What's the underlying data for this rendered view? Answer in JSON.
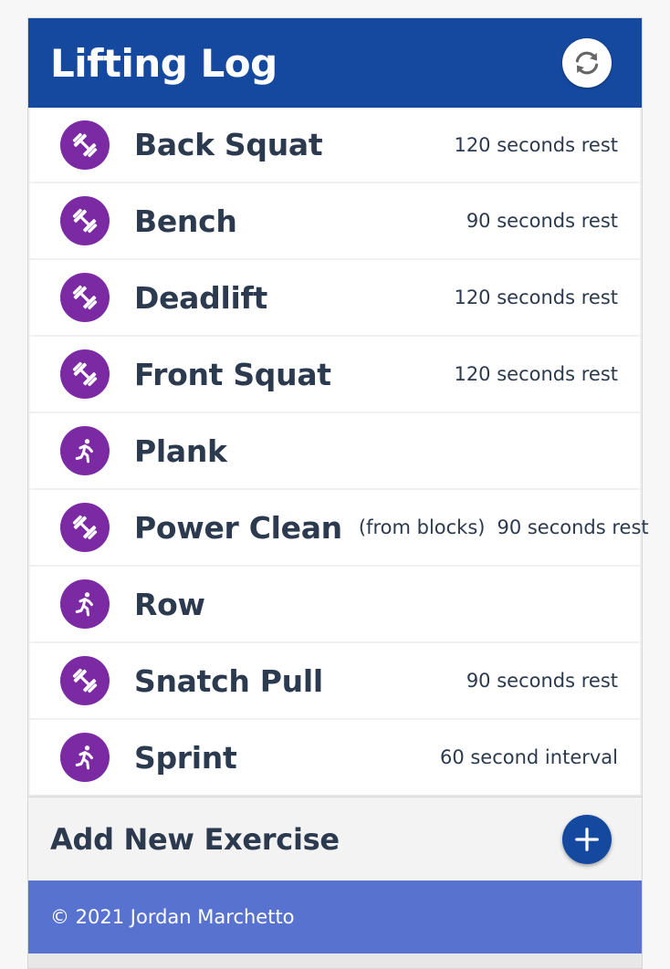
{
  "app": {
    "title": "Lifting Log",
    "sync_icon": "sync-icon"
  },
  "colors": {
    "header_bg": "#1549a0",
    "avatar_bg": "#7b2aa3",
    "text": "#2b3a4e",
    "footer_bg": "#5873cf"
  },
  "exercises": [
    {
      "name": "Back Squat",
      "note": "",
      "rest": "120 seconds rest",
      "icon": "dumbbell-icon"
    },
    {
      "name": "Bench",
      "note": "",
      "rest": "90 seconds rest",
      "icon": "dumbbell-icon"
    },
    {
      "name": "Deadlift",
      "note": "",
      "rest": "120 seconds rest",
      "icon": "dumbbell-icon"
    },
    {
      "name": "Front Squat",
      "note": "",
      "rest": "120 seconds rest",
      "icon": "dumbbell-icon"
    },
    {
      "name": "Plank",
      "note": "",
      "rest": "",
      "icon": "running-icon"
    },
    {
      "name": "Power Clean",
      "note": "(from blocks)",
      "rest": "90 seconds rest",
      "icon": "dumbbell-icon"
    },
    {
      "name": "Row",
      "note": "",
      "rest": "",
      "icon": "running-icon"
    },
    {
      "name": "Snatch Pull",
      "note": "",
      "rest": "90 seconds rest",
      "icon": "dumbbell-icon"
    },
    {
      "name": "Sprint",
      "note": "",
      "rest": "60 second interval",
      "icon": "running-icon"
    }
  ],
  "add_exercise": {
    "label": "Add New Exercise",
    "icon": "plus-icon"
  },
  "footer": {
    "copyright": "© 2021 Jordan Marchetto"
  }
}
